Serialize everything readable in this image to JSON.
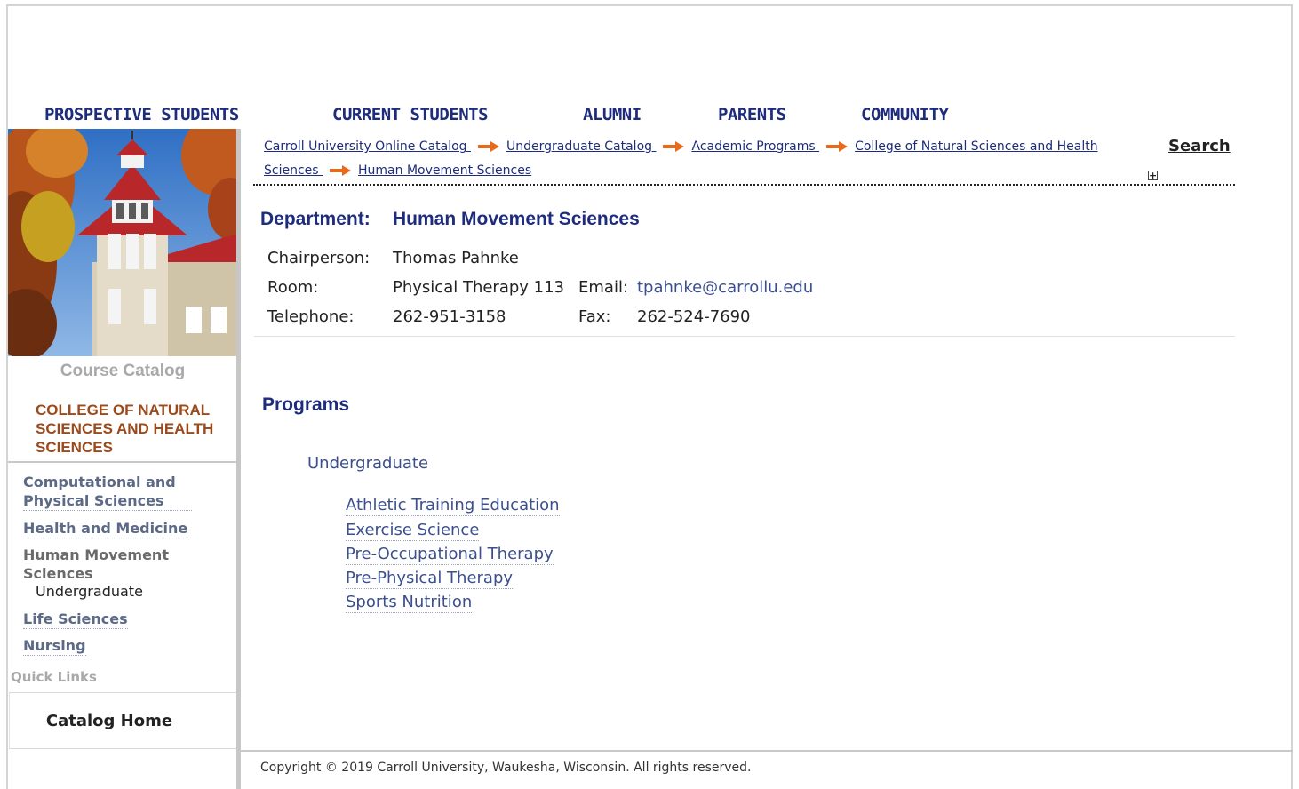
{
  "topnav": {
    "prospective": "PROSPECTIVE STUDENTS",
    "current": "CURRENT STUDENTS",
    "alumni": "ALUMNI",
    "parents": "PARENTS",
    "community": "COMMUNITY"
  },
  "sidebar": {
    "course_catalog": "Course Catalog",
    "college": "COLLEGE OF NATURAL SCIENCES AND HEALTH SCIENCES",
    "items": [
      {
        "label": "Computational and Physical Sciences"
      },
      {
        "label": "Health and Medicine"
      },
      {
        "label": "Human Movement Sciences"
      },
      {
        "label": "Undergraduate"
      },
      {
        "label": "Life Sciences"
      },
      {
        "label": "Nursing"
      }
    ],
    "quick_links": "Quick Links",
    "catalog_home": "Catalog Home"
  },
  "breadcrumb": {
    "items": [
      "Carroll University Online Catalog ",
      "Undergraduate Catalog ",
      "Academic Programs ",
      "College of Natural Sciences and Health",
      "Sciences ",
      "Human Movement Sciences"
    ]
  },
  "search": {
    "label": "Search"
  },
  "department": {
    "label": "Department:",
    "name": "Human Movement Sciences",
    "chair_label": "Chairperson:",
    "chair_value": "Thomas Pahnke",
    "room_label": "Room:",
    "room_value": "Physical Therapy 113",
    "email_label": "Email:",
    "email_value": "tpahnke@carrollu.edu",
    "phone_label": "Telephone:",
    "phone_value": "262-951-3158",
    "fax_label": "Fax:",
    "fax_value": "262-524-7690"
  },
  "programs": {
    "heading": "Programs",
    "level": "Undergraduate",
    "items": [
      "Athletic Training Education",
      "Exercise Science",
      "Pre-Occupational Therapy",
      "Pre-Physical Therapy",
      "Sports Nutrition"
    ]
  },
  "footer": {
    "text": "Copyright © 2019 Carroll University, Waukesha, Wisconsin. All rights reserved."
  },
  "colors": {
    "navy": "#1d2c7c",
    "link": "#3b4f8e",
    "rust": "#9c4a1b",
    "arrow": "#e86a1a"
  },
  "icons": {
    "breadcrumb_separator": "arrow-right-icon",
    "expand": "plus-box-icon"
  }
}
